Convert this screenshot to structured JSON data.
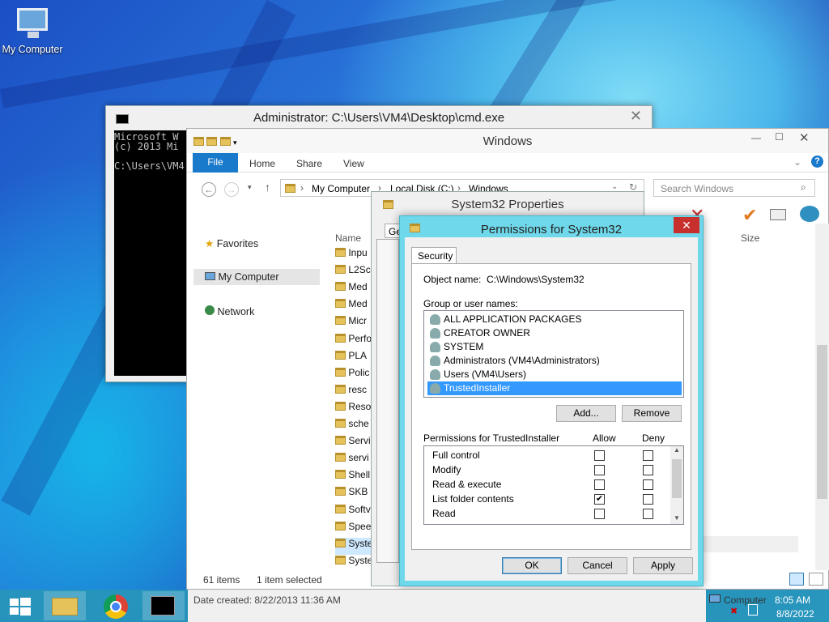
{
  "desktop": {
    "icon_label": "My Computer"
  },
  "cmd": {
    "title": "Administrator: C:\\Users\\VM4\\Desktop\\cmd.exe",
    "lines": [
      "Microsoft W",
      "(c) 2013 Mi",
      "",
      "C:\\Users\\VM4"
    ]
  },
  "explorer": {
    "title": "Windows",
    "tabs": [
      "File",
      "Home",
      "Share",
      "View"
    ],
    "address": {
      "part1": "My Computer",
      "part2": "Local Disk (C:)",
      "part3": "Windows"
    },
    "search_placeholder": "Search Windows",
    "nav": [
      "Favorites",
      "My Computer",
      "Network"
    ],
    "col_name": "Name",
    "col_size": "Size",
    "files": [
      "Inpu",
      "L2Sc",
      "Med",
      "Med",
      "Micr",
      "Perfo",
      "PLA",
      "Polic",
      "resc",
      "Reso",
      "sche",
      "Servi",
      "servi",
      "Shell",
      "SKB",
      "Softv",
      "Spee",
      "Syste",
      "Syste"
    ],
    "status_items": "61 items",
    "status_selected": "1 item selected"
  },
  "props": {
    "title": "System32 Properties",
    "tab": "Ge"
  },
  "perm": {
    "title": "Permissions for System32",
    "tab": "Security",
    "object_label": "Object name:",
    "object_value": "C:\\Windows\\System32",
    "group_label": "Group or user names:",
    "users": [
      "ALL APPLICATION PACKAGES",
      "CREATOR OWNER",
      "SYSTEM",
      "Administrators (VM4\\Administrators)",
      "Users (VM4\\Users)",
      "TrustedInstaller"
    ],
    "add_btn": "Add...",
    "remove_btn": "Remove",
    "perms_label": "Permissions for TrustedInstaller",
    "allow": "Allow",
    "deny": "Deny",
    "perms": [
      {
        "name": "Full control",
        "allow": false,
        "deny": false
      },
      {
        "name": "Modify",
        "allow": false,
        "deny": false
      },
      {
        "name": "Read & execute",
        "allow": false,
        "deny": false
      },
      {
        "name": "List folder contents",
        "allow": true,
        "deny": false
      },
      {
        "name": "Read",
        "allow": false,
        "deny": false
      }
    ],
    "ok": "OK",
    "cancel": "Cancel",
    "apply": "Apply"
  },
  "taskbar": {
    "status": "Date created: 8/22/2013 11:36 AM",
    "tray_label": "Computer",
    "time": "8:05 AM",
    "date": "8/8/2022"
  },
  "colors": {
    "accent": "#1979ca",
    "selection": "#3399ff",
    "dialog_frame": "#6fd8ea"
  }
}
